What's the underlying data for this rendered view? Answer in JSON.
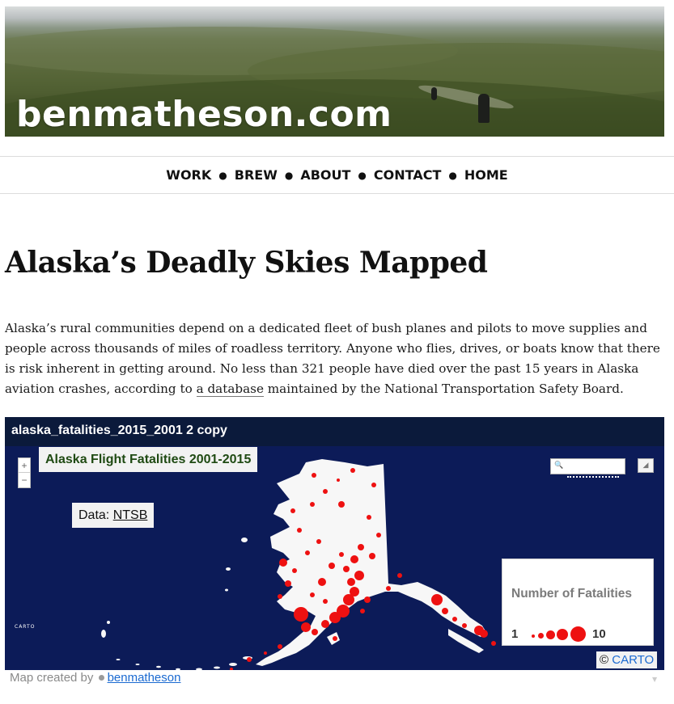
{
  "header": {
    "site_title": "benmatheson.com"
  },
  "nav": {
    "items": [
      "WORK",
      "BREW",
      "ABOUT",
      "CONTACT",
      "HOME"
    ],
    "separator": "●"
  },
  "article": {
    "headline": "Alaska’s Deadly Skies Mapped",
    "intro_before": "Alaska’s rural communities depend on a dedicated fleet of bush planes and pilots to move supplies and people across thousands of miles of roadless territory. Anyone who flies, drives, or boats know that there is risk inherent in getting around. No less than 321 people have died over the past 15 years in Alaska aviation crashes, according to ",
    "intro_link": "a database",
    "intro_after": " maintained by the National Transportation Safety Board."
  },
  "map": {
    "embed_title": "alaska_fatalities_2015_2001 2 copy",
    "zoom_in": "+",
    "zoom_out": "−",
    "title": "Alaska Flight Fatalities 2001-2015",
    "data_label": "Data: ",
    "data_source": "NTSB",
    "legend": {
      "title": "Number of Fatalities",
      "min": "1",
      "max": "10"
    },
    "carto_logo": "CARTO",
    "attribution_symbol": "©",
    "attribution_link": "CARTO",
    "footer_text": "Map created by",
    "footer_author": "benmatheson",
    "colors": {
      "ocean": "#0c1b58",
      "land": "#f7f7f7",
      "bubble": "#ee1111"
    }
  }
}
